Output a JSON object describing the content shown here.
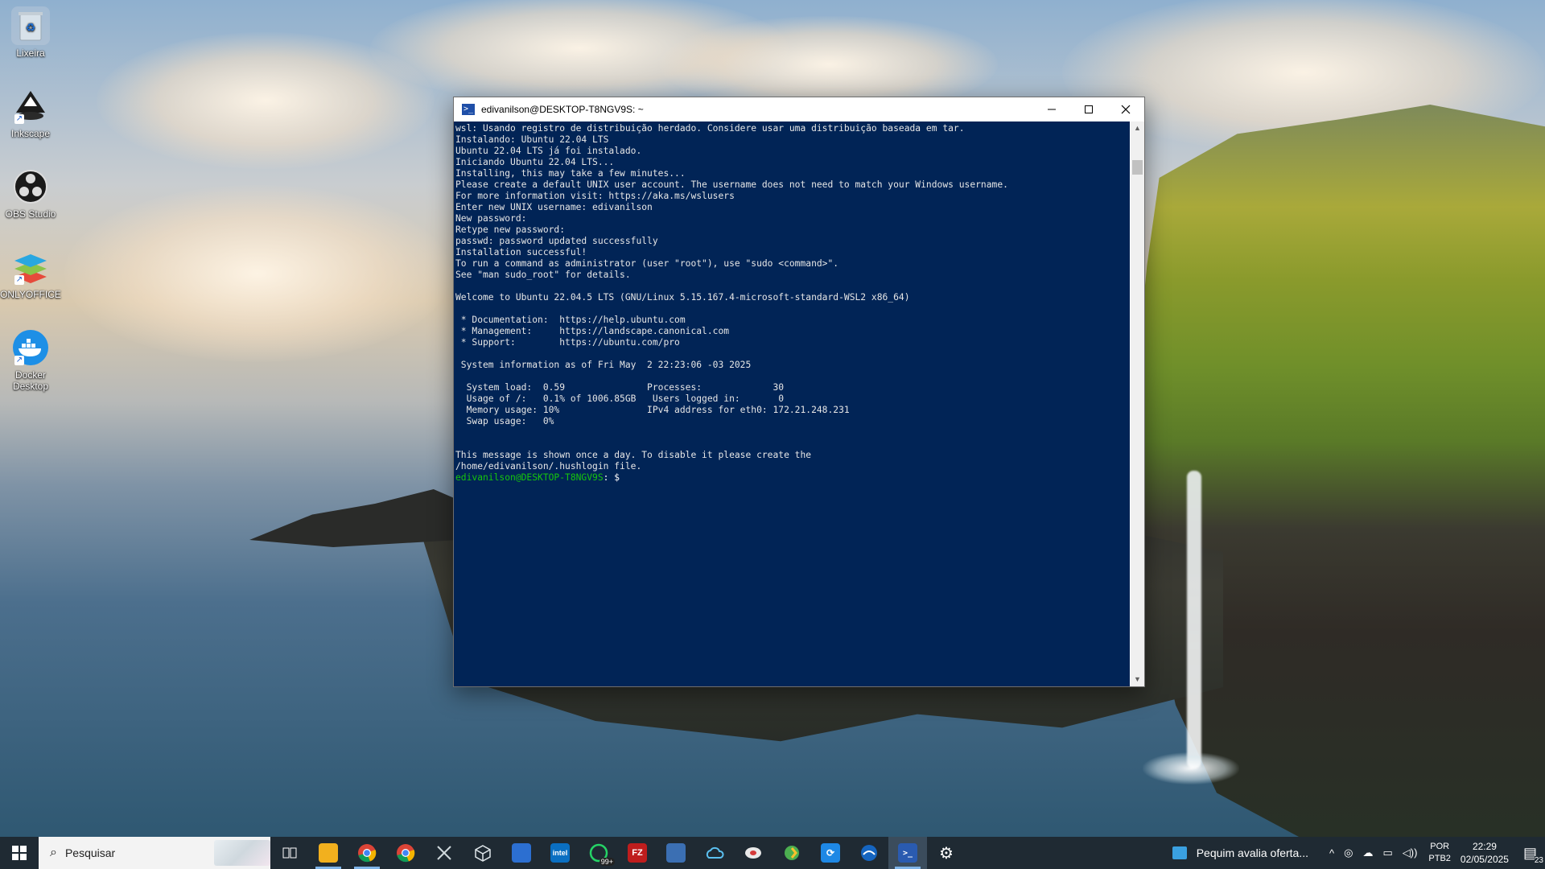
{
  "desktop": {
    "icons": [
      {
        "label": "Lixeira",
        "icon": "recycle-bin-icon"
      },
      {
        "label": "Inkscape",
        "icon": "inkscape-icon"
      },
      {
        "label": "OBS Studio",
        "icon": "obs-icon"
      },
      {
        "label": "ONLYOFFICE",
        "icon": "onlyoffice-icon"
      },
      {
        "label": "Docker Desktop",
        "icon": "docker-icon"
      }
    ]
  },
  "terminal": {
    "title": "edivanilson@DESKTOP-T8NGV9S: ~",
    "lines": [
      "wsl: Usando registro de distribuição herdado. Considere usar uma distribuição baseada em tar.",
      "Instalando: Ubuntu 22.04 LTS",
      "Ubuntu 22.04 LTS já foi instalado.",
      "Iniciando Ubuntu 22.04 LTS...",
      "Installing, this may take a few minutes...",
      "Please create a default UNIX user account. The username does not need to match your Windows username.",
      "For more information visit: https://aka.ms/wslusers",
      "Enter new UNIX username: edivanilson",
      "New password:",
      "Retype new password:",
      "passwd: password updated successfully",
      "Installation successful!",
      "To run a command as administrator (user \"root\"), use \"sudo <command>\".",
      "See \"man sudo_root\" for details.",
      "",
      "Welcome to Ubuntu 22.04.5 LTS (GNU/Linux 5.15.167.4-microsoft-standard-WSL2 x86_64)",
      "",
      " * Documentation:  https://help.ubuntu.com",
      " * Management:     https://landscape.canonical.com",
      " * Support:        https://ubuntu.com/pro",
      "",
      " System information as of Fri May  2 22:23:06 -03 2025",
      "",
      "  System load:  0.59               Processes:             30",
      "  Usage of /:   0.1% of 1006.85GB   Users logged in:       0",
      "  Memory usage: 10%                IPv4 address for eth0: 172.21.248.231",
      "  Swap usage:   0%",
      "",
      "",
      "This message is shown once a day. To disable it please create the",
      "/home/edivanilson/.hushlogin file."
    ],
    "prompt_user": "edivanilson@DESKTOP-T8NGV9S",
    "prompt_suffix": ": $"
  },
  "taskbar": {
    "search_placeholder": "Pesquisar",
    "apps": [
      {
        "name": "task-view",
        "label": ""
      },
      {
        "name": "file-explorer",
        "label": ""
      },
      {
        "name": "chrome-1",
        "label": ""
      },
      {
        "name": "chrome-2",
        "label": ""
      },
      {
        "name": "snipping-tool",
        "label": ""
      },
      {
        "name": "3d-viewer",
        "label": ""
      },
      {
        "name": "app-device",
        "label": ""
      },
      {
        "name": "intel",
        "label": "intel"
      },
      {
        "name": "whatsapp",
        "label": "99+"
      },
      {
        "name": "filezilla",
        "label": "FZ"
      },
      {
        "name": "network-tool",
        "label": ""
      },
      {
        "name": "onedrive",
        "label": ""
      },
      {
        "name": "vpn-app",
        "label": ""
      },
      {
        "name": "gnome-app",
        "label": ""
      },
      {
        "name": "sync-app",
        "label": ""
      },
      {
        "name": "vpn-shield",
        "label": ""
      },
      {
        "name": "powershell",
        "label": ">_"
      },
      {
        "name": "settings",
        "label": "⚙"
      }
    ],
    "news": "Pequim avalia oferta...",
    "lang_primary": "POR",
    "lang_secondary": "PTB2",
    "time": "22:29",
    "date": "02/05/2025",
    "notification_count": "23"
  }
}
